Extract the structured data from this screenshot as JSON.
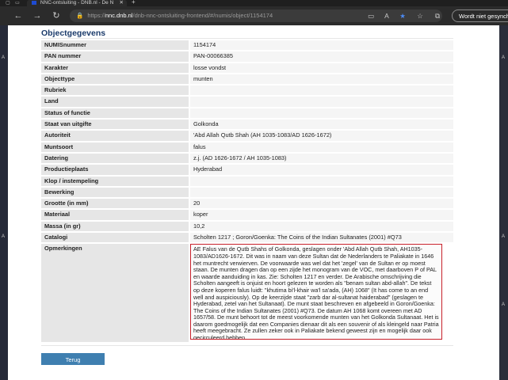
{
  "browser": {
    "tab_title": "NNC-ontsluiting - DNB.nl - De N",
    "address_host": "nnc.dnb.nl",
    "address_path": "/dnb-nnc-ontsluiting-frontend/#/numis/object/1154174",
    "address_prefix": "https://",
    "profile_button": "Wordt niet gesynchron"
  },
  "desktop": {
    "left_labels": [
      "A",
      "A"
    ],
    "right_labels": [
      "A",
      "A",
      "A"
    ]
  },
  "page": {
    "title": "Objectgegevens",
    "fields": [
      {
        "label": "NUMISnummer",
        "value": "1154174"
      },
      {
        "label": "PAN nummer",
        "value": "PAN-00066385"
      },
      {
        "label": "Karakter",
        "value": "losse vondst"
      },
      {
        "label": "Objecttype",
        "value": "munten"
      },
      {
        "label": "Rubriek",
        "value": ""
      },
      {
        "label": "Land",
        "value": ""
      },
      {
        "label": "Status of functie",
        "value": ""
      },
      {
        "label": "Staat van uitgifte",
        "value": "Golkonda"
      },
      {
        "label": "Autoriteit",
        "value": "'Abd Allah Qutb Shah (AH 1035-1083/AD 1626-1672)"
      },
      {
        "label": "Muntsoort",
        "value": "falus"
      },
      {
        "label": "Datering",
        "value": "z.j. (AD 1626-1672 / AH 1035-1083)"
      },
      {
        "label": "Productieplaats",
        "value": "Hyderabad"
      },
      {
        "label": "Klop / instempeling",
        "value": ""
      },
      {
        "label": "Bewerking",
        "value": ""
      },
      {
        "label": "Grootte (in mm)",
        "value": "20"
      },
      {
        "label": "Materiaal",
        "value": "koper"
      },
      {
        "label": "Massa (in gr)",
        "value": "10,2"
      },
      {
        "label": "Catalogi",
        "value": "Scholten 1217 ; Goron/Goenka: The Coins of the Indian Sultanates (2001) #Q73"
      }
    ],
    "remarks_label": "Opmerkingen",
    "remarks_text": "AE Falus van de Qutb Shahs of Golkonda, geslagen onder 'Abd Allah Qutb Shah, AH1035-1083/AD1626-1672. Dit was in naam van deze Sultan dat de Nederlanders te Paliakate in 1646 het muntrecht verwierven. De voorwaarde was wel dat het 'zegel' van de Sultan er op moest staan. De munten dragen dan op een zijde het monogram van de VOC, met daarboven P of PAL en waarde aanduiding in kas. Zie: Scholten 1217 en verder. De Arabische omschrijving die Scholten aangeeft is onjuist en hoort gelezen te worden als \"benam sultan abd-allah\". De tekst op deze koperen falus luidt: \"khutima bi'l-khair wa'l sa'ada, (AH) 1068\" (It has come to an end well and auspiciously). Op de keerzijde staat \"zarb dar al-sultanat haiderabad\" (geslagen te Hyderabad, zetel van het Sultanaat). De munt staat beschreven en afgebeeld in Goron/Goenka: The Coins of the Indian Sultanates (2001) #Q73. De datum AH 1068 komt overeen met AD 1657/58. De munt behoort tot de meest voorkomende munten van het Golkonda Sultanaat. Het is daarom goedmogelijk dat een Companies dienaar dit als een souvenir of als kleingeld naar Patria heeft meegebracht. Ze zullen zeker ook in Paliakate bekend geweest zijn en mogelijk daar ook gecirculeerd hebben.",
    "back_button": "Terug"
  }
}
